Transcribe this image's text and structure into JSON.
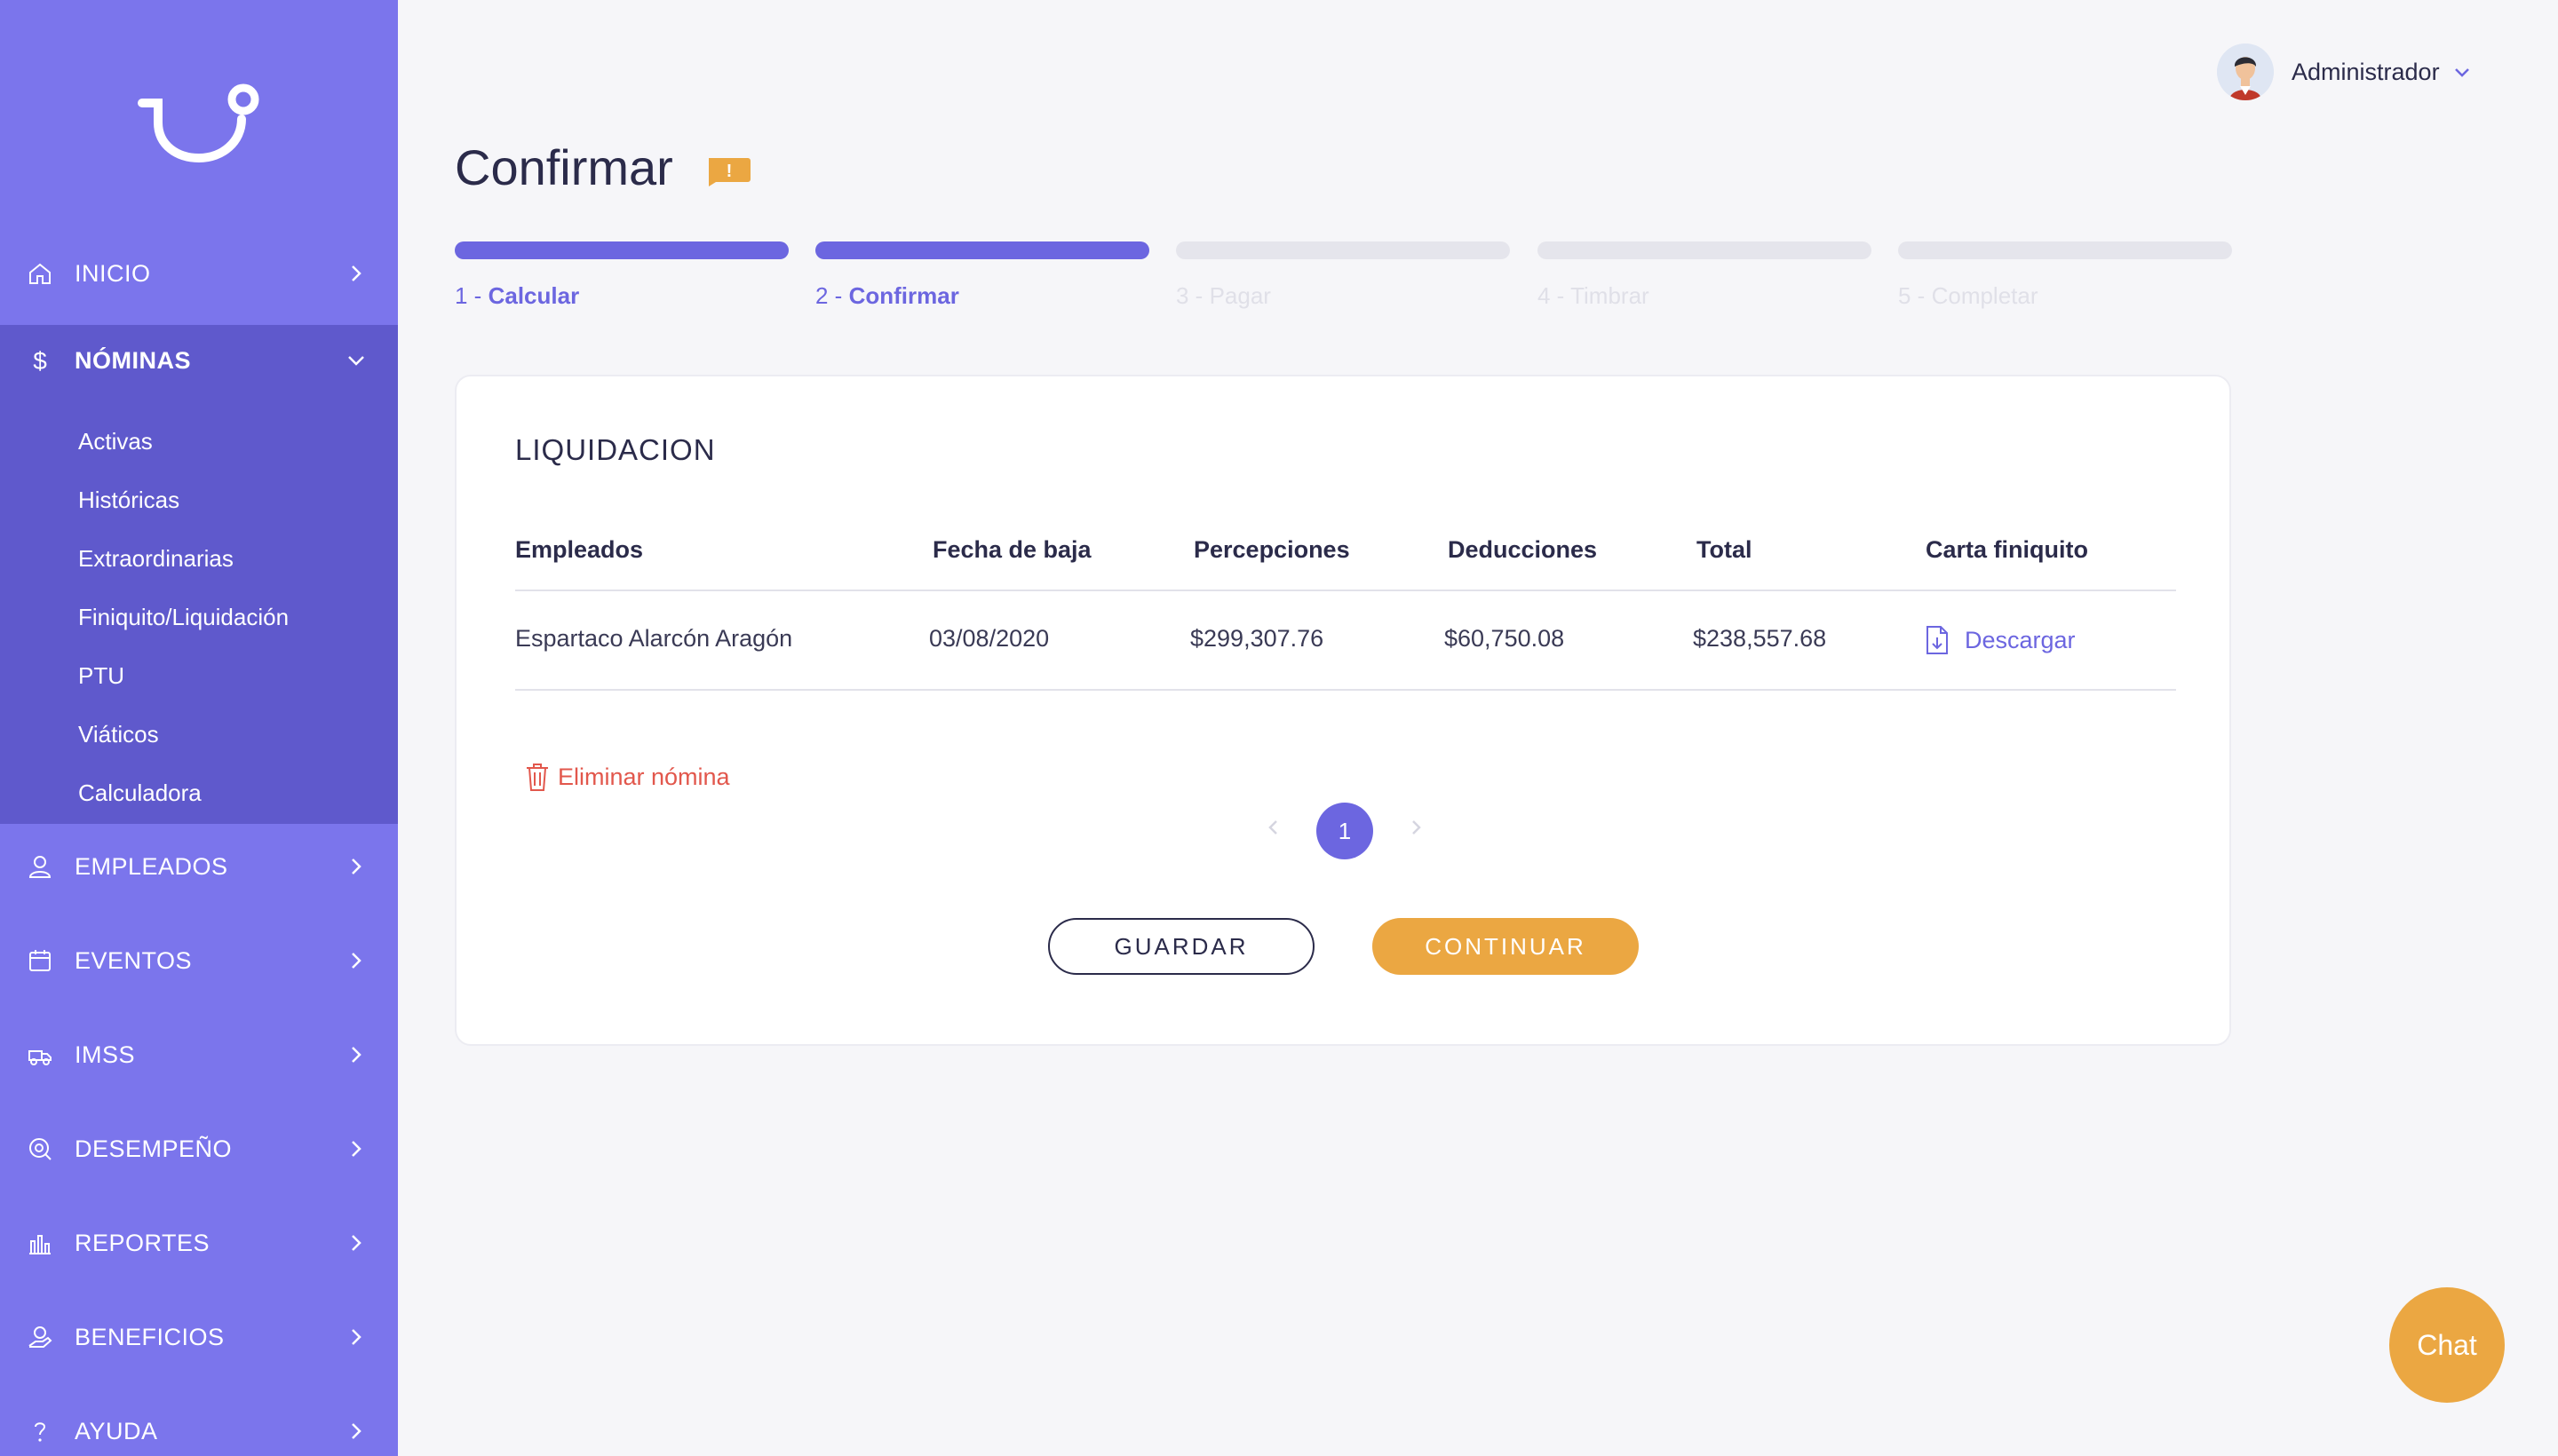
{
  "sidebar": {
    "items": [
      {
        "label": "INICIO",
        "icon": "home-icon"
      },
      {
        "label": "NÓMINAS",
        "icon": "dollar-icon"
      },
      {
        "label": "EMPLEADOS",
        "icon": "user-icon"
      },
      {
        "label": "EVENTOS",
        "icon": "calendar-icon"
      },
      {
        "label": "IMSS",
        "icon": "ambulance-icon"
      },
      {
        "label": "DESEMPEÑO",
        "icon": "performance-icon"
      },
      {
        "label": "REPORTES",
        "icon": "bar-chart-icon"
      },
      {
        "label": "BENEFICIOS",
        "icon": "benefits-icon"
      },
      {
        "label": "AYUDA",
        "icon": "help-icon"
      }
    ],
    "submenu": [
      "Activas",
      "Históricas",
      "Extraordinarias",
      "Finiquito/Liquidación",
      "PTU",
      "Viáticos",
      "Calculadora"
    ]
  },
  "header": {
    "user_name": "Administrador"
  },
  "page": {
    "title": "Confirmar",
    "warning_mark": "!"
  },
  "stepper": [
    {
      "num": "1 - ",
      "name": "Calcular",
      "state": "done"
    },
    {
      "num": "2 - ",
      "name": "Confirmar",
      "state": "active"
    },
    {
      "num": "3 - ",
      "name": "Pagar",
      "state": "pending"
    },
    {
      "num": "4 - ",
      "name": "Timbrar",
      "state": "pending"
    },
    {
      "num": "5 - ",
      "name": "Completar",
      "state": "pending"
    }
  ],
  "card": {
    "title": "LIQUIDACION",
    "columns": [
      "Empleados",
      "Fecha de baja",
      "Percepciones",
      "Deducciones",
      "Total",
      "Carta finiquito"
    ],
    "rows": [
      {
        "empleado": "Espartaco Alarcón Aragón",
        "fecha": "03/08/2020",
        "percepciones": "$299,307.76",
        "deducciones": "$60,750.08",
        "total": "$238,557.68",
        "carta": "Descargar"
      }
    ],
    "delete_label": "Eliminar nómina",
    "current_page": "1",
    "save_label": "GUARDAR",
    "continue_label": "CONTINUAR"
  },
  "chat_label": "Chat",
  "colors": {
    "sidebar": "#7b75ec",
    "sidebar_active": "#5f59cc",
    "accent": "#6c66e0",
    "primary_button": "#eba742",
    "danger": "#e2574c"
  }
}
